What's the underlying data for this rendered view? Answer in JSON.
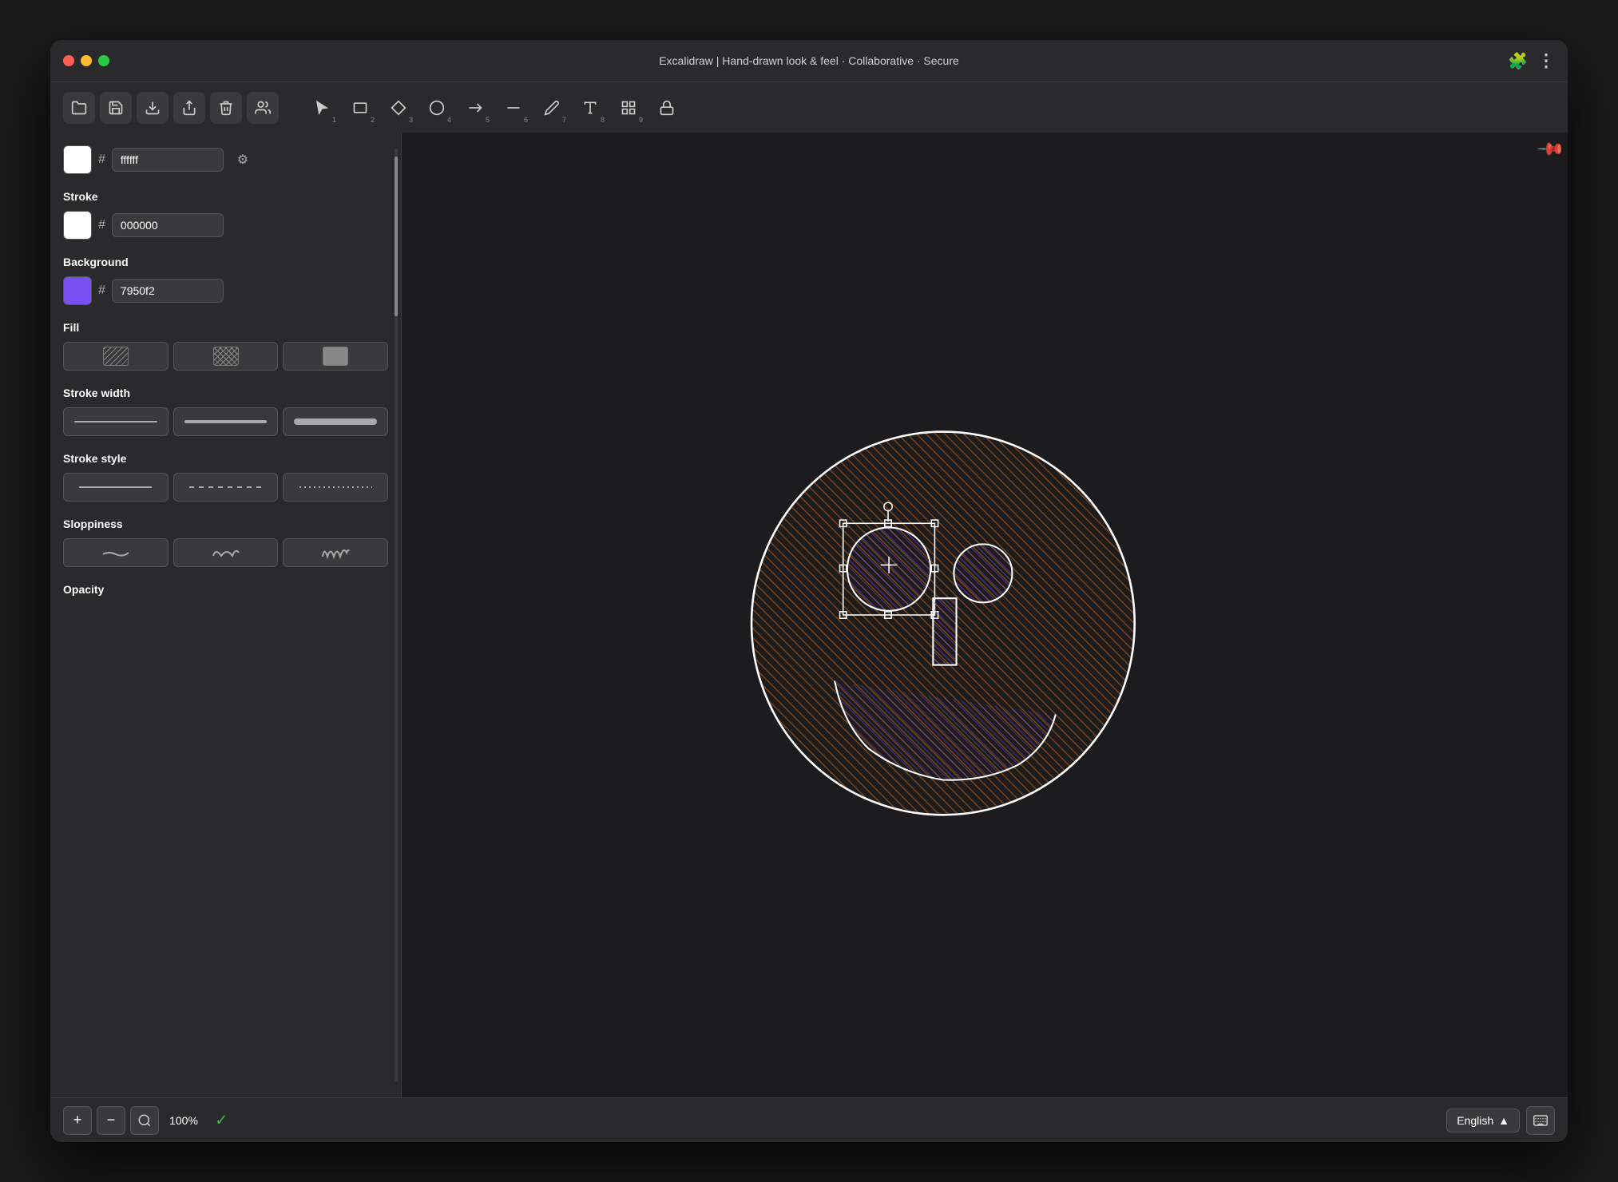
{
  "window": {
    "title": "Excalidraw | Hand-drawn look & feel · Collaborative · Secure"
  },
  "titlebar": {
    "title": "Excalidraw | Hand-drawn look & feel · Collaborative · Secure",
    "extensions_icon": "🧩",
    "menu_icon": "⋮"
  },
  "toolbar_left": {
    "open_label": "open",
    "save_label": "save",
    "export_label": "export",
    "share_label": "share",
    "delete_label": "delete",
    "collab_label": "collaborate"
  },
  "tools": [
    {
      "name": "select",
      "icon": "↖",
      "number": "1"
    },
    {
      "name": "rectangle",
      "icon": "□",
      "number": "2"
    },
    {
      "name": "diamond",
      "icon": "◆",
      "number": "3"
    },
    {
      "name": "ellipse",
      "icon": "●",
      "number": "4"
    },
    {
      "name": "arrow",
      "icon": "→",
      "number": "5"
    },
    {
      "name": "line",
      "icon": "—",
      "number": "6"
    },
    {
      "name": "pencil",
      "icon": "✏",
      "number": "7"
    },
    {
      "name": "text",
      "icon": "A",
      "number": "8"
    },
    {
      "name": "image",
      "icon": "⊞",
      "number": "9"
    },
    {
      "name": "lock",
      "icon": "🔓",
      "number": ""
    }
  ],
  "sidebar": {
    "color_section": {
      "swatch_color": "#ffffff",
      "hash": "#",
      "value": "ffffff",
      "settings_icon": "⚙"
    },
    "stroke": {
      "label": "Stroke",
      "swatch_color": "#ffffff",
      "hash": "#",
      "value": "000000"
    },
    "background": {
      "label": "Background",
      "swatch_color": "#7950f2",
      "hash": "#",
      "value": "7950f2"
    },
    "fill": {
      "label": "Fill",
      "options": [
        "hatch",
        "cross-hatch",
        "solid"
      ]
    },
    "stroke_width": {
      "label": "Stroke width",
      "options": [
        "thin",
        "medium",
        "thick"
      ]
    },
    "stroke_style": {
      "label": "Stroke style",
      "options": [
        "solid",
        "dashed",
        "dotted"
      ]
    },
    "sloppiness": {
      "label": "Sloppiness",
      "options": [
        "low",
        "medium",
        "high"
      ]
    },
    "opacity": {
      "label": "Opacity"
    }
  },
  "bottom_bar": {
    "zoom_in_label": "+",
    "zoom_out_label": "−",
    "zoom_reset_label": "zoom reset",
    "zoom_level": "100%",
    "status_icon": "✓",
    "language": "English",
    "chevron_up": "▲",
    "keyboard_icon": "⌨"
  }
}
